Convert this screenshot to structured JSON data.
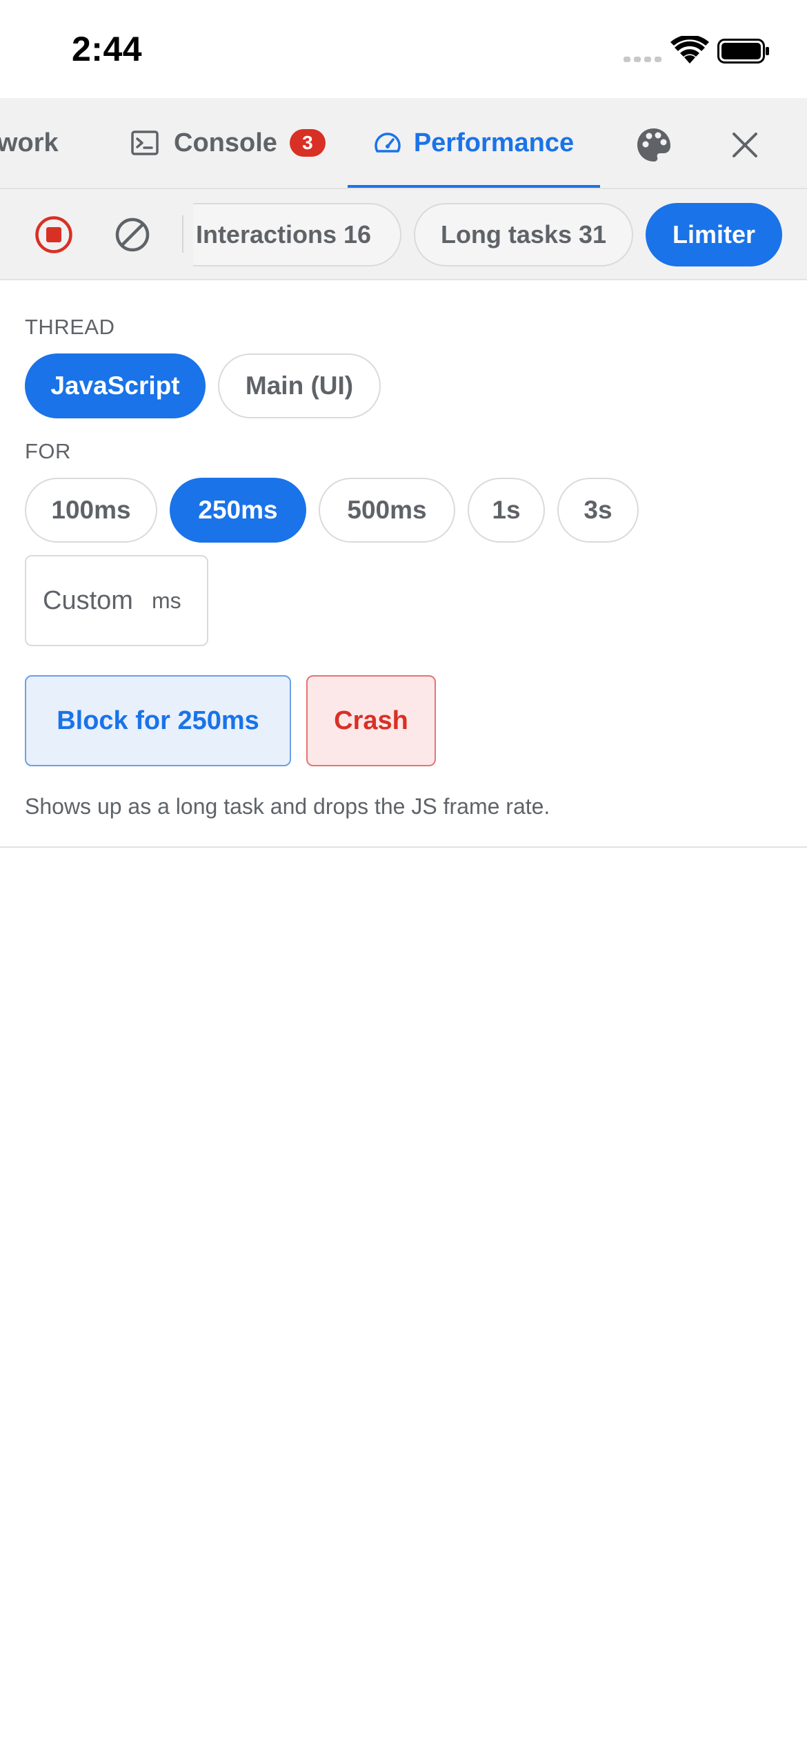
{
  "status_bar": {
    "time": "2:44"
  },
  "tabs": {
    "network_label": "work",
    "console_label": "Console",
    "console_badge": "3",
    "performance_label": "Performance",
    "active": "Performance"
  },
  "toolbar": {
    "chips": {
      "interactions": "Interactions 16",
      "long_tasks": "Long tasks 31",
      "limiter": "Limiter"
    },
    "active_chip": "Limiter"
  },
  "limiter": {
    "thread_label": "THREAD",
    "thread_options": [
      "JavaScript",
      "Main (UI)"
    ],
    "thread_selected": "JavaScript",
    "for_label": "FOR",
    "duration_options": [
      "100ms",
      "250ms",
      "500ms",
      "1s",
      "3s"
    ],
    "duration_selected": "250ms",
    "custom_placeholder": "Custom",
    "custom_value": "",
    "custom_unit": "ms",
    "block_button": "Block for 250ms",
    "crash_button": "Crash",
    "hint": "Shows up as a long task and drops the JS frame rate."
  },
  "icons": {
    "console": "terminal-icon",
    "performance": "speedometer-icon",
    "theme": "palette-icon",
    "close": "close-icon",
    "record": "record-stop-icon",
    "clear": "clear-icon"
  },
  "colors": {
    "accent": "#1a73e8",
    "danger": "#d93025",
    "toolbar_bg": "#f1f1f1",
    "text_secondary": "#5f6368"
  }
}
